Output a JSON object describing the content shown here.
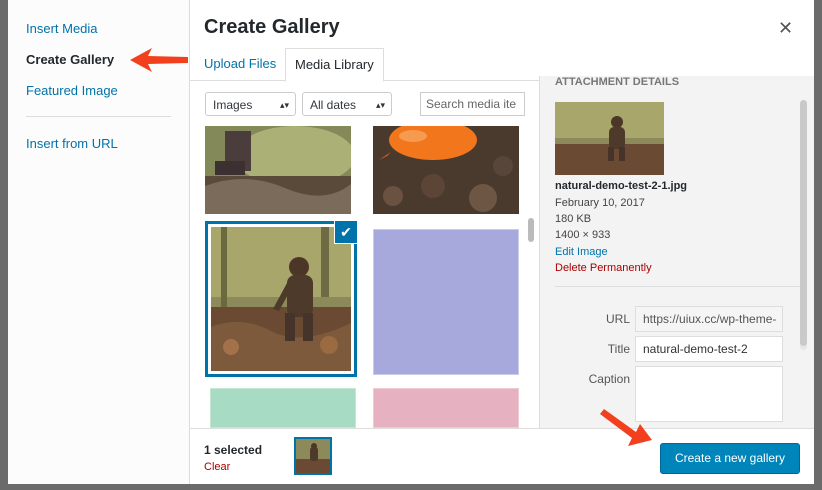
{
  "menu": {
    "items": [
      {
        "label": "Insert Media"
      },
      {
        "label": "Create Gallery"
      },
      {
        "label": "Featured Image"
      },
      {
        "label": "Insert from URL"
      }
    ]
  },
  "header": {
    "title": "Create Gallery",
    "close_icon": "close-icon"
  },
  "tabs": [
    {
      "label": "Upload Files"
    },
    {
      "label": "Media Library"
    }
  ],
  "toolbar": {
    "filter_type": "Images",
    "filter_date": "All dates",
    "search_placeholder": "Search media ite"
  },
  "details": {
    "heading": "ATTACHMENT DETAILS",
    "filename": "natural-demo-test-2-1.jpg",
    "date": "February 10, 2017",
    "size": "180 KB",
    "dimensions": "1400 × 933",
    "edit_link": "Edit Image",
    "delete_link": "Delete Permanently",
    "fields": {
      "url_label": "URL",
      "url_value": "https://uiux.cc/wp-theme-",
      "title_label": "Title",
      "title_value": "natural-demo-test-2",
      "caption_label": "Caption",
      "caption_value": ""
    }
  },
  "footer": {
    "selected": "1 selected",
    "clear": "Clear",
    "button": "Create a new gallery"
  },
  "colors": {
    "link": "#0073aa",
    "primary": "#0085ba",
    "danger": "#a00",
    "arrow": "#f2401f"
  }
}
